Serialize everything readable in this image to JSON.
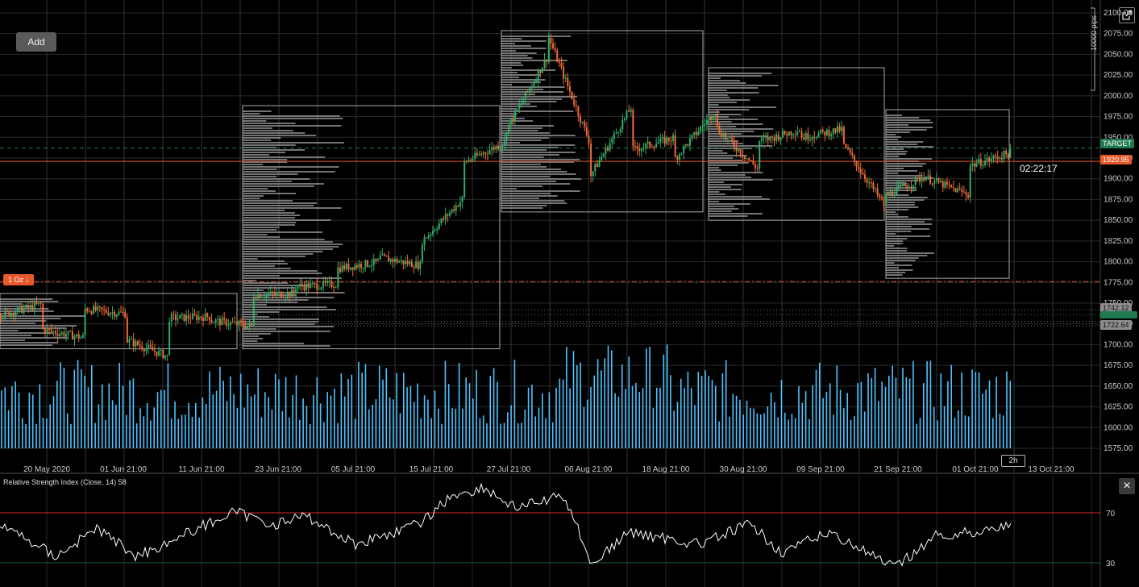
{
  "toolbar": {
    "add_label": "Add"
  },
  "icons": {
    "popout": "popout-icon",
    "close": "close-icon",
    "arrow_down": "arrow-down-icon"
  },
  "colors": {
    "background": "#000000",
    "bull_candle": "#2fae6a",
    "bear_candle": "#f06a35",
    "volume": "#4ec3ff",
    "target_line": "#1e7a4e",
    "price_line": "#e8582b",
    "rsi_line": "#ffffff",
    "rsi_level": "#d02a2a",
    "profile": "#9a9a9a"
  },
  "price_axis": {
    "labels": [
      "2100.00",
      "2075.00",
      "2050.00",
      "2025.00",
      "2000.00",
      "1975.00",
      "1950.00",
      "1925.00",
      "1900.00",
      "1875.00",
      "1850.00",
      "1825.00",
      "1800.00",
      "1775.00",
      "1750.00",
      "1725.00",
      "1700.00",
      "1675.00",
      "1650.00",
      "1625.00",
      "1600.00",
      "1575.00"
    ],
    "pips_label": "10000 pips"
  },
  "time_axis": {
    "labels": [
      "20 May 2020",
      "01 Jun 21:00",
      "11 Jun 21:00",
      "23 Jun 21:00",
      "05 Jul 21:00",
      "15 Jul 21:00",
      "27 Jul 21:00",
      "06 Aug 21:00",
      "18 Aug 21:00",
      "30 Aug 21:00",
      "09 Sep 21:00",
      "21 Sep 21:00",
      "01 Oct 21:00",
      "13 Oct 21:00"
    ]
  },
  "price_tags": {
    "target": "TARGET",
    "current_price": "1920.95",
    "level_1": "1742.12",
    "level_2": "1722.64"
  },
  "countdown": "02:22:17",
  "order_marker": {
    "label": "1 Oz"
  },
  "interval": "2h",
  "rsi": {
    "label": "Relative Strength Index (Close, 14) 58",
    "levels": [
      "70",
      "30"
    ]
  },
  "chart_data": {
    "type": "candlestick",
    "symbol_price": 1920.95,
    "ylim": [
      1560,
      2105
    ],
    "levels": {
      "target": 1937,
      "current": 1920.95,
      "order": 1776,
      "level_1": 1742.12,
      "level_2": 1722.64
    },
    "price_path": [
      [
        1736,
        1749
      ],
      [
        1718,
        1708
      ],
      [
        1743,
        1737
      ],
      [
        1705,
        1685
      ],
      [
        1732,
        1734
      ],
      [
        1729,
        1722
      ],
      [
        1760,
        1762
      ],
      [
        1770,
        1773
      ],
      [
        1792,
        1800
      ],
      [
        1805,
        1795
      ],
      [
        1825,
        1878
      ],
      [
        1920,
        1945
      ],
      [
        1960,
        2050
      ],
      [
        2070,
        1940
      ],
      [
        1905,
        1990
      ],
      [
        1935,
        1950
      ],
      [
        1925,
        1985
      ],
      [
        1960,
        1910
      ],
      [
        1945,
        1960
      ],
      [
        1950,
        1960
      ],
      [
        1940,
        1865
      ],
      [
        1880,
        1905
      ],
      [
        1900,
        1880
      ],
      [
        1916,
        1932
      ]
    ],
    "volume_profiles": [
      {
        "from": "20 May 2020",
        "to": "23 Jun 21:00",
        "range": [
          1695,
          1762
        ]
      },
      {
        "from": "23 Jun 21:00",
        "to": "27 Jul 21:00",
        "range": [
          1695,
          1985
        ]
      },
      {
        "from": "27 Jul 21:00",
        "to": "24 Aug 21:00",
        "range": [
          1860,
          2078
        ]
      },
      {
        "from": "25 Aug 21:00",
        "to": "21 Sep 21:00",
        "range": [
          1850,
          2035
        ]
      },
      {
        "from": "21 Sep 21:00",
        "to": "10 Oct 21:00",
        "range": [
          1780,
          1985
        ]
      }
    ],
    "rsi": {
      "last": 58,
      "levels": [
        70,
        30
      ]
    }
  }
}
